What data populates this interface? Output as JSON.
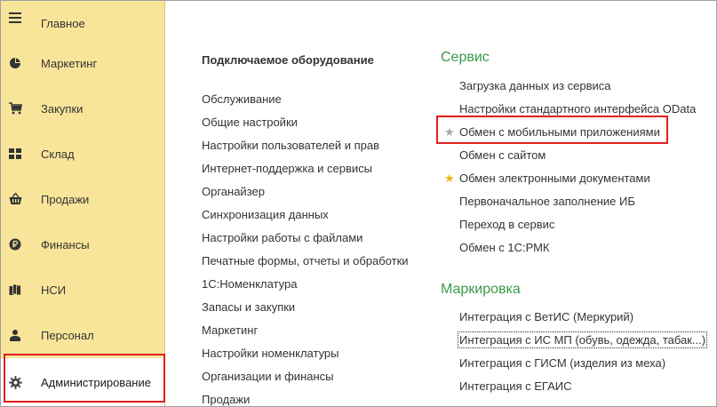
{
  "sidebar": {
    "items": [
      {
        "label": "Главное",
        "icon": "menu-lines-icon"
      },
      {
        "label": "Маркетинг",
        "icon": "pie-chart-icon"
      },
      {
        "label": "Закупки",
        "icon": "cart-icon"
      },
      {
        "label": "Склад",
        "icon": "warehouse-grid-icon"
      },
      {
        "label": "Продажи",
        "icon": "basket-icon"
      },
      {
        "label": "Финансы",
        "icon": "ruble-coin-icon"
      },
      {
        "label": "НСИ",
        "icon": "documents-icon"
      },
      {
        "label": "Персонал",
        "icon": "person-icon"
      },
      {
        "label": "Администрирование",
        "icon": "gear-icon"
      }
    ],
    "active_index": 8
  },
  "column1": {
    "title": "Подключаемое оборудование",
    "links": [
      "Обслуживание",
      "Общие настройки",
      "Настройки пользователей и прав",
      "Интернет-поддержка и сервисы",
      "Органайзер",
      "Синхронизация данных",
      "Настройки работы с файлами",
      "Печатные формы, отчеты и обработки",
      "1С:Номенклатура",
      "Запасы и закупки",
      "Маркетинг",
      "Настройки номенклатуры",
      "Организации и финансы",
      "Продажи"
    ]
  },
  "service": {
    "title": "Сервис",
    "links": [
      {
        "label": "Загрузка данных из сервиса",
        "star": ""
      },
      {
        "label": "Настройки стандартного интерфейса OData",
        "star": ""
      },
      {
        "label": "Обмен с мобильными приложениями",
        "star": "gray"
      },
      {
        "label": "Обмен с сайтом",
        "star": ""
      },
      {
        "label": "Обмен электронными документами",
        "star": "gold"
      },
      {
        "label": "Первоначальное заполнение ИБ",
        "star": ""
      },
      {
        "label": "Переход в сервис",
        "star": ""
      },
      {
        "label": "Обмен с 1С:РМК",
        "star": ""
      }
    ]
  },
  "marking": {
    "title": "Маркировка",
    "links": [
      "Интеграция с ВетИС (Меркурий)",
      "Интеграция с ИС МП (обувь, одежда, табак...)",
      "Интеграция с ГИСМ (изделия из меха)",
      "Интеграция с ЕГАИС"
    ]
  },
  "colors": {
    "sidebar_bg": "#f9e59a",
    "section_title": "#3a9a4a",
    "highlight_box": "#e0201c",
    "favorite_star": "#f2b31a",
    "star_inactive": "#a8a8a8"
  }
}
